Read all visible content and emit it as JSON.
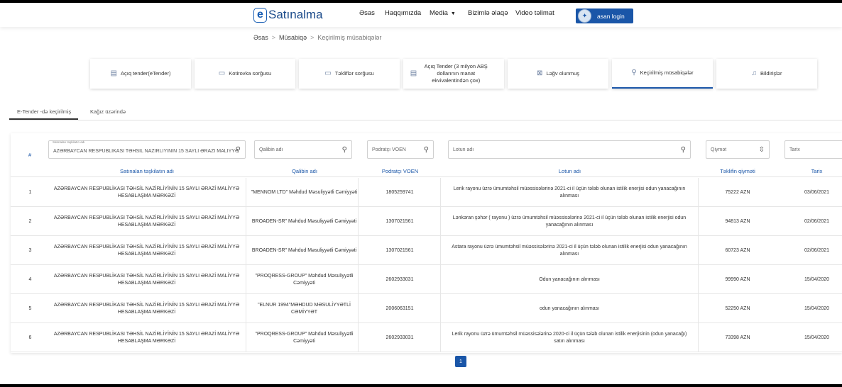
{
  "header": {
    "logo_letter": "e",
    "logo_text": "Satınalma",
    "nav": [
      "Əsas",
      "Haqqımızda",
      "Media",
      "Bizimlə əlaqə",
      "Video təlimat"
    ],
    "asan_login": "asan login"
  },
  "breadcrumb": [
    "Əsas",
    "Müsabiqə",
    "Keçirilmiş müsabiqələr"
  ],
  "cards": [
    {
      "label": "Açıq tender(eTender)",
      "icon": "tender-icon"
    },
    {
      "label": "Kotirovka sorğusu",
      "icon": "chat-icon"
    },
    {
      "label": "Təkliflər sorğusu",
      "icon": "comments-icon"
    },
    {
      "label": "Açıq Tender (3 milyon ABŞ dollarının manat ekvivalentindən çox)",
      "icon": "tender-icon"
    },
    {
      "label": "Ləğv olunmuş",
      "icon": "cancel-icon"
    },
    {
      "label": "Keçirilmiş müsabiqələr",
      "icon": "link-icon",
      "active": true
    },
    {
      "label": "Bildirişlər",
      "icon": "bell-icon"
    }
  ],
  "subtabs": [
    "E-Tender -də keçirilmiş",
    "Kağız üzərində"
  ],
  "filters": {
    "org_label": "Satınalan təşkilatın adı",
    "org_value": "AZƏRBAYCAN RESPUBLİKASI TƏHSİL NAZİRLİYİNİN 15 SAYLI ƏRAZİ MALİYYƏ H",
    "winner": "Qalibin adı",
    "voen": "Podratçı VOEN",
    "lot": "Lotun adı",
    "price": "Qiymət",
    "date": "Tarix"
  },
  "columns": {
    "num": "#",
    "org": "Satınalan təşkilatın adı",
    "winner": "Qalibin adı",
    "voen": "Podratçı VOEN",
    "lot": "Lotun adı",
    "price": "Təklifin qiyməti",
    "date": "Tarix"
  },
  "rows": [
    {
      "num": "1",
      "org": "AZƏRBAYCAN RESPUBLİKASI TƏHSİL NAZİRLİYİNİN 15 SAYLI ƏRAZİ MALİYYƏ HESABLAŞMA MƏRKƏZİ",
      "winner": "\"MENNOM LTD\" Məhdud Məsuliyyətli Cəmiyyəti",
      "voen": "1805259741",
      "lot": "Lerik rayonu üzrə ümumtəhsil müəssisələrinə 2021-ci il üçün tələb olunan istilik enerjisi odun yanacağının alınması",
      "price": "75222 AZN",
      "date": "03/06/2021"
    },
    {
      "num": "2",
      "org": "AZƏRBAYCAN RESPUBLİKASI TƏHSİL NAZİRLİYİNİN 15 SAYLI ƏRAZİ MALİYYƏ HESABLAŞMA MƏRKƏZİ",
      "winner": "BROADEN-SR\" Məhdud Məsuliyyətli Cəmiyyəti",
      "voen": "1307021561",
      "lot": "Lənkəran şəhər ( rayonu ) üzrə ümumtəhsil müəssisələrinə 2021-ci il üçün tələb olunan istilik enerjisi odun yanacağının alınması",
      "price": "94813 AZN",
      "date": "02/06/2021"
    },
    {
      "num": "3",
      "org": "AZƏRBAYCAN RESPUBLİKASI TƏHSİL NAZİRLİYİNİN 15 SAYLI ƏRAZİ MALİYYƏ HESABLAŞMA MƏRKƏZİ",
      "winner": "BROADEN-SR\" Məhdud Məsuliyyətli Cəmiyyəti",
      "voen": "1307021561",
      "lot": "Astara rayonu üzrə ümumtəhsil müəssisələrinə 2021-ci il üçün tələb olunan istilik enerjisi odun yanacağının alınması",
      "price": "60723 AZN",
      "date": "02/06/2021"
    },
    {
      "num": "4",
      "org": "AZƏRBAYCAN RESPUBLİKASI TƏHSİL NAZİRLİYİNİN 15 SAYLI ƏRAZİ MALİYYƏ HESABLAŞMA MƏRKƏZİ",
      "winner": "\"PROQRESS-GROUP\" Məhdud Məsuliyyətli Cəmiyyəti",
      "voen": "2602933031",
      "lot": "Odun yanacağının alınması",
      "price": "99990 AZN",
      "date": "15/04/2020"
    },
    {
      "num": "5",
      "org": "AZƏRBAYCAN RESPUBLİKASI TƏHSİL NAZİRLİYİNİN 15 SAYLI ƏRAZİ MALİYYƏ HESABLAŞMA MƏRKƏZİ",
      "winner": "\"ELNUR 1994\"MƏHDUD MƏSULİYYƏTLİ CƏMİYYƏT",
      "voen": "2006063151",
      "lot": "odun yanacağının alınması",
      "price": "52250 AZN",
      "date": "15/04/2020"
    },
    {
      "num": "6",
      "org": "AZƏRBAYCAN RESPUBLİKASI TƏHSİL NAZİRLİYİNİN 15 SAYLI ƏRAZİ MALİYYƏ HESABLAŞMA MƏRKƏZİ",
      "winner": "\"PROQRESS-GROUP\" Məhdud Məsuliyyətli Cəmiyyəti",
      "voen": "2602933031",
      "lot": "Lerik rayonu üzrə ümumtəhsil müəssisələrinə 2020-ci il üçün tələb olunan istilik enerjisinin (odun yanacağı) satın alınması",
      "price": "73398 AZN",
      "date": "15/04/2020"
    }
  ],
  "pagination": {
    "current": "1"
  }
}
